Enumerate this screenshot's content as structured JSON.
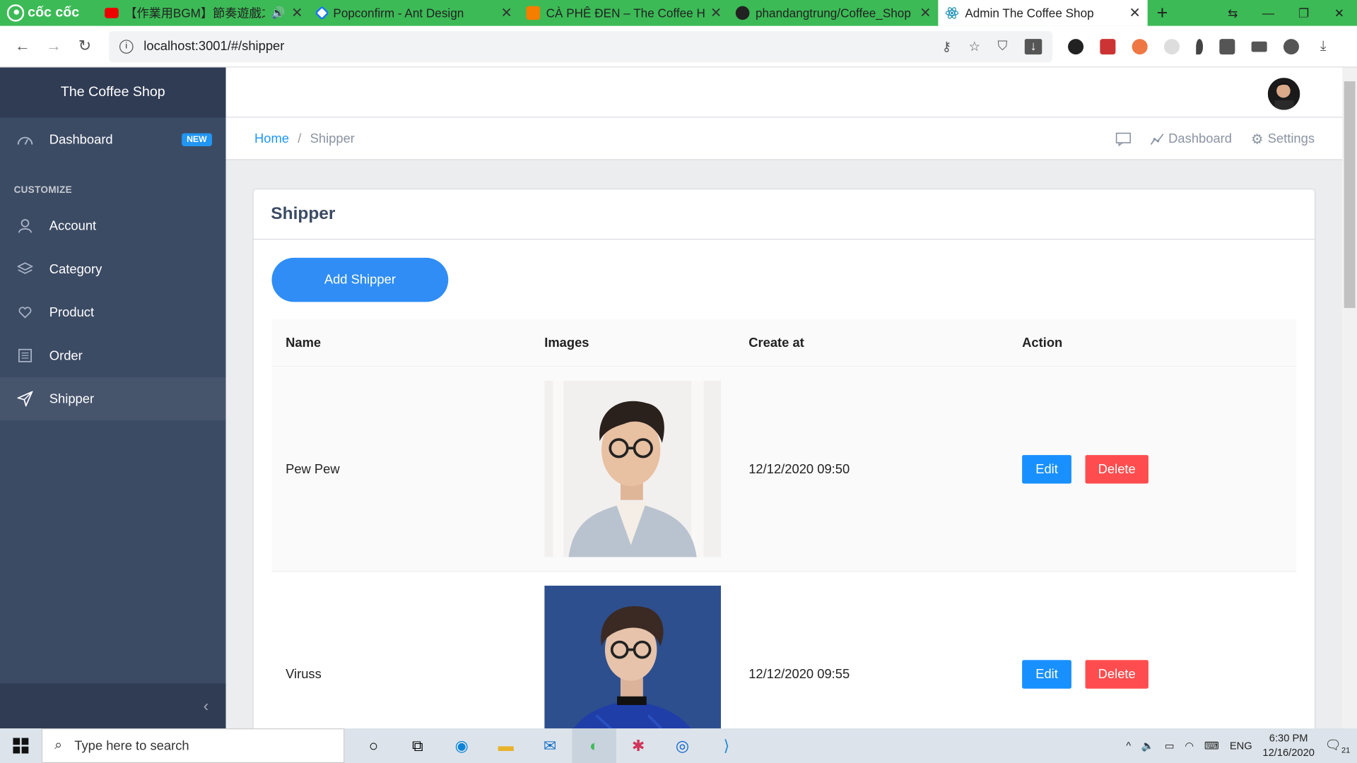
{
  "browser": {
    "logo": "cốc cốc",
    "tabs": [
      {
        "title": "【作業用BGM】節奏遊戲之",
        "active": false
      },
      {
        "title": "Popconfirm - Ant Design",
        "active": false
      },
      {
        "title": "CÀ PHÊ ĐEN – The Coffee Ho",
        "active": false
      },
      {
        "title": "phandangtrung/Coffee_Shop",
        "active": false
      },
      {
        "title": "Admin The Coffee Shop",
        "active": true
      }
    ],
    "url": "localhost:3001/#/shipper"
  },
  "sidebar": {
    "brand": "The Coffee Shop",
    "dashboard": {
      "label": "Dashboard",
      "badge": "NEW"
    },
    "section_title": "CUSTOMIZE",
    "items": [
      {
        "label": "Account",
        "icon": "user-icon"
      },
      {
        "label": "Category",
        "icon": "layers-icon"
      },
      {
        "label": "Product",
        "icon": "heart-hand-icon"
      },
      {
        "label": "Order",
        "icon": "list-icon"
      },
      {
        "label": "Shipper",
        "icon": "send-icon",
        "active": true
      }
    ]
  },
  "breadcrumb": {
    "home": "Home",
    "separator": "/",
    "current": "Shipper"
  },
  "header_nav": {
    "dashboard": "Dashboard",
    "settings": "Settings"
  },
  "page": {
    "title": "Shipper",
    "add_button": "Add Shipper",
    "columns": [
      "Name",
      "Images",
      "Create at",
      "Action"
    ],
    "rows": [
      {
        "name": "Pew Pew",
        "created": "12/12/2020 09:50",
        "edit": "Edit",
        "delete": "Delete"
      },
      {
        "name": "Viruss",
        "created": "12/12/2020 09:55",
        "edit": "Edit",
        "delete": "Delete"
      }
    ]
  },
  "taskbar": {
    "search_placeholder": "Type here to search",
    "lang": "ENG",
    "time": "6:30 PM",
    "date": "12/16/2020",
    "notifications": "21"
  },
  "colors": {
    "sidebar": "#3c4b64",
    "primary": "#1890ff",
    "danger": "#ff4d4f",
    "browser": "#3cba56"
  }
}
